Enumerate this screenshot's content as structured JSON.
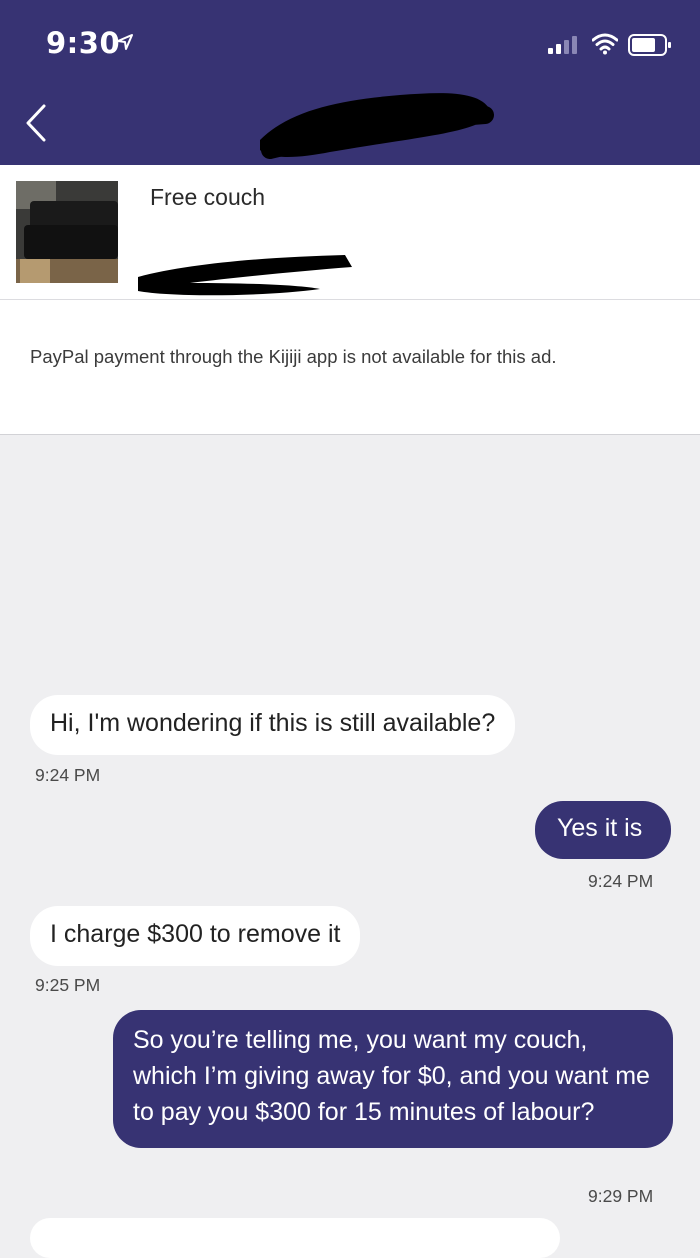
{
  "status_bar": {
    "time": "9:30"
  },
  "listing": {
    "title": "Free couch"
  },
  "notice": {
    "text": "PayPal payment through the Kijiji app is not available for this ad."
  },
  "messages": [
    {
      "text": "Hi, I'm wondering if this is still available?",
      "time": "9:24 PM",
      "direction": "incoming"
    },
    {
      "text": "Yes it is",
      "time": "9:24 PM",
      "direction": "outgoing"
    },
    {
      "text": "I charge $300 to remove it",
      "time": "9:25 PM",
      "direction": "incoming"
    },
    {
      "text": "So you’re telling me, you want my couch, which I’m giving away for $0, and you want me to pay you $300 for 15 minutes of labour?",
      "time": "9:29 PM",
      "direction": "outgoing"
    }
  ],
  "colors": {
    "header": "#373373",
    "outgoing_bubble": "#373373",
    "incoming_bubble": "#ffffff",
    "background": "#efeff1"
  },
  "icons": [
    "location-arrow-icon",
    "signal-icon",
    "wifi-icon",
    "battery-icon",
    "back-chevron-icon"
  ]
}
